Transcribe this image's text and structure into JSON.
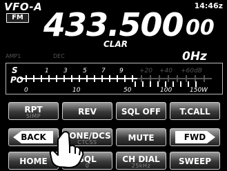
{
  "header": {
    "vfo_label": "VFO-A",
    "clock": "14:46z",
    "mode": "FM",
    "frequency_main": "433.500",
    "frequency_small": "00",
    "clar": "CLAR",
    "amp": "AMP1",
    "dec": "DEC",
    "clar_offset": "0Hz"
  },
  "meter": {
    "s_label": "S",
    "po_label": "PO",
    "s_scale": [
      "1",
      "3",
      "5",
      "7",
      "9",
      "+20",
      "+40",
      "+60dB"
    ],
    "po_scale": [
      "0",
      "10",
      "50",
      "100",
      "150W"
    ]
  },
  "buttons": {
    "rpt": {
      "label": "RPT",
      "sub": "SIMP"
    },
    "rev": {
      "label": "REV"
    },
    "sql_off": {
      "label": "SQL OFF"
    },
    "t_call": {
      "label": "T.CALL"
    },
    "back": {
      "label": "BACK"
    },
    "tone_dcs": {
      "label": "TONE/DCS",
      "sub": "CTCSS"
    },
    "mute": {
      "label": "MUTE"
    },
    "fwd": {
      "label": "FWD"
    },
    "home": {
      "label": "HOME"
    },
    "sql": {
      "label": "SQL",
      "sub": "0"
    },
    "ch_dial": {
      "label": "CH DIAL",
      "sub": "25kHz"
    },
    "sweep": {
      "label": "SWEEP"
    }
  },
  "colors": {
    "background": "#000000",
    "text": "#ffffff",
    "sublabel": "#888888"
  }
}
